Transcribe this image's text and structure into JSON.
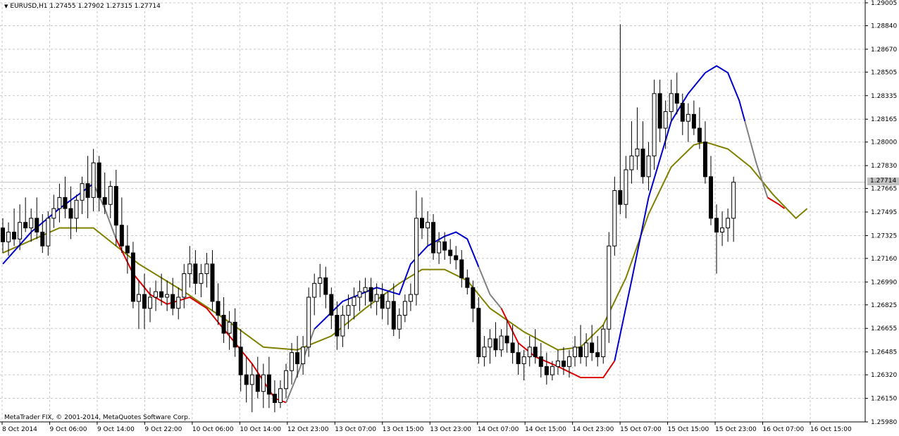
{
  "header": {
    "symbol_period": "EURUSD,H1",
    "open": "1.27455",
    "high": "1.27902",
    "low": "1.27315",
    "close": "1.27714"
  },
  "footer": {
    "copyright": "MetaTrader FIX, © 2001-2014, MetaQuotes Software Corp."
  },
  "current_price_label": "1.27714",
  "colors": {
    "background": "#ffffff",
    "grid": "#c8c8c8",
    "candle_bull_fill": "#ffffff",
    "candle_bear_fill": "#000000",
    "candle_outline": "#000000",
    "ma_slow": "#808000",
    "ma_fast_up": "#0000cc",
    "ma_fast_down": "#dd0000",
    "ma_fast_flat": "#808080",
    "bid_line": "#c0c0c0"
  },
  "chart_data": {
    "type": "candlestick",
    "symbol": "EURUSD",
    "timeframe": "H1",
    "grid": true,
    "ylim": [
      1.2598,
      1.29005
    ],
    "y_ticks": [
      "1.29005",
      "1.28840",
      "1.28670",
      "1.28505",
      "1.28335",
      "1.28165",
      "1.28000",
      "1.27830",
      "1.27665",
      "1.27495",
      "1.27325",
      "1.27160",
      "1.26990",
      "1.26825",
      "1.26655",
      "1.26485",
      "1.26320",
      "1.26150",
      "1.25980"
    ],
    "x_ticks": [
      "8 Oct 2014",
      "9 Oct 06:00",
      "9 Oct 14:00",
      "9 Oct 22:00",
      "10 Oct 06:00",
      "10 Oct 14:00",
      "12 Oct 23:00",
      "13 Oct 07:00",
      "13 Oct 15:00",
      "13 Oct 23:00",
      "14 Oct 07:00",
      "14 Oct 15:00",
      "14 Oct 23:00",
      "15 Oct 07:00",
      "15 Oct 15:00",
      "15 Oct 23:00",
      "16 Oct 07:00",
      "16 Oct 15:00"
    ],
    "candles": [
      [
        1.2738,
        1.2745,
        1.272,
        1.2728
      ],
      [
        1.2728,
        1.2742,
        1.2718,
        1.2735
      ],
      [
        1.2735,
        1.2752,
        1.2725,
        1.273
      ],
      [
        1.273,
        1.2755,
        1.2722,
        1.2742
      ],
      [
        1.2742,
        1.276,
        1.2735,
        1.2738
      ],
      [
        1.2738,
        1.2752,
        1.2728,
        1.2745
      ],
      [
        1.2745,
        1.276,
        1.273,
        1.2735
      ],
      [
        1.2735,
        1.2748,
        1.272,
        1.2725
      ],
      [
        1.2725,
        1.275,
        1.2718,
        1.2745
      ],
      [
        1.2745,
        1.2762,
        1.2738,
        1.2752
      ],
      [
        1.2752,
        1.277,
        1.2742,
        1.276
      ],
      [
        1.276,
        1.2775,
        1.2745,
        1.2752
      ],
      [
        1.2752,
        1.2768,
        1.273,
        1.2745
      ],
      [
        1.2745,
        1.2762,
        1.2735,
        1.2758
      ],
      [
        1.2758,
        1.2775,
        1.2748,
        1.277
      ],
      [
        1.277,
        1.279,
        1.2745,
        1.276
      ],
      [
        1.276,
        1.2795,
        1.275,
        1.2785
      ],
      [
        1.2785,
        1.279,
        1.275,
        1.276
      ],
      [
        1.276,
        1.2778,
        1.2748,
        1.2755
      ],
      [
        1.2755,
        1.2772,
        1.2745,
        1.2768
      ],
      [
        1.2768,
        1.278,
        1.2725,
        1.274
      ],
      [
        1.274,
        1.276,
        1.272,
        1.2725
      ],
      [
        1.2725,
        1.274,
        1.2705,
        1.272
      ],
      [
        1.272,
        1.2728,
        1.268,
        1.2685
      ],
      [
        1.2685,
        1.27,
        1.2665,
        1.269
      ],
      [
        1.269,
        1.2705,
        1.2665,
        1.268
      ],
      [
        1.268,
        1.2695,
        1.267,
        1.2688
      ],
      [
        1.2688,
        1.27,
        1.2678,
        1.2692
      ],
      [
        1.2692,
        1.2705,
        1.2682,
        1.2688
      ],
      [
        1.2688,
        1.27,
        1.2678,
        1.269
      ],
      [
        1.269,
        1.2702,
        1.2675,
        1.268
      ],
      [
        1.268,
        1.2695,
        1.2672,
        1.2688
      ],
      [
        1.2688,
        1.2712,
        1.268,
        1.2705
      ],
      [
        1.2705,
        1.2725,
        1.2695,
        1.2712
      ],
      [
        1.2712,
        1.2722,
        1.269,
        1.2698
      ],
      [
        1.2698,
        1.2712,
        1.2688,
        1.2705
      ],
      [
        1.2705,
        1.272,
        1.2695,
        1.2712
      ],
      [
        1.2712,
        1.2722,
        1.2678,
        1.2685
      ],
      [
        1.2685,
        1.2698,
        1.2668,
        1.2675
      ],
      [
        1.2675,
        1.2688,
        1.2655,
        1.2662
      ],
      [
        1.2662,
        1.2678,
        1.265,
        1.267
      ],
      [
        1.267,
        1.268,
        1.2645,
        1.2652
      ],
      [
        1.2652,
        1.2665,
        1.262,
        1.2632
      ],
      [
        1.2632,
        1.2645,
        1.2612,
        1.2625
      ],
      [
        1.2625,
        1.264,
        1.2605,
        1.2632
      ],
      [
        1.2632,
        1.2645,
        1.2615,
        1.262
      ],
      [
        1.262,
        1.264,
        1.2608,
        1.2632
      ],
      [
        1.2632,
        1.2645,
        1.2608,
        1.2618
      ],
      [
        1.2618,
        1.2628,
        1.2605,
        1.2612
      ],
      [
        1.2612,
        1.2628,
        1.2608,
        1.2622
      ],
      [
        1.2622,
        1.264,
        1.2615,
        1.2635
      ],
      [
        1.2635,
        1.2655,
        1.2625,
        1.2648
      ],
      [
        1.2648,
        1.266,
        1.263,
        1.264
      ],
      [
        1.264,
        1.266,
        1.2632,
        1.2652
      ],
      [
        1.2652,
        1.2695,
        1.2645,
        1.2688
      ],
      [
        1.2688,
        1.2705,
        1.2675,
        1.2698
      ],
      [
        1.2698,
        1.2712,
        1.2688,
        1.2702
      ],
      [
        1.2702,
        1.271,
        1.268,
        1.269
      ],
      [
        1.269,
        1.2695,
        1.2665,
        1.2675
      ],
      [
        1.2675,
        1.2685,
        1.265,
        1.266
      ],
      [
        1.266,
        1.2682,
        1.2652,
        1.2675
      ],
      [
        1.2675,
        1.269,
        1.2665,
        1.2682
      ],
      [
        1.2682,
        1.2695,
        1.2672,
        1.2688
      ],
      [
        1.2688,
        1.27,
        1.2678,
        1.2692
      ],
      [
        1.2692,
        1.2702,
        1.2682,
        1.2695
      ],
      [
        1.2695,
        1.2702,
        1.268,
        1.2685
      ],
      [
        1.2685,
        1.2698,
        1.2675,
        1.269
      ],
      [
        1.269,
        1.2698,
        1.2672,
        1.268
      ],
      [
        1.268,
        1.2692,
        1.2668,
        1.2685
      ],
      [
        1.2685,
        1.2698,
        1.266,
        1.2665
      ],
      [
        1.2665,
        1.268,
        1.2658,
        1.2675
      ],
      [
        1.2675,
        1.269,
        1.267,
        1.2685
      ],
      [
        1.2685,
        1.2698,
        1.2678,
        1.269
      ],
      [
        1.269,
        1.2765,
        1.2682,
        1.2745
      ],
      [
        1.2745,
        1.276,
        1.273,
        1.2738
      ],
      [
        1.2738,
        1.275,
        1.2725,
        1.2742
      ],
      [
        1.2742,
        1.2748,
        1.2715,
        1.272
      ],
      [
        1.272,
        1.2735,
        1.2712,
        1.2728
      ],
      [
        1.2728,
        1.2735,
        1.2715,
        1.2722
      ],
      [
        1.2722,
        1.273,
        1.2712,
        1.2718
      ],
      [
        1.2718,
        1.2725,
        1.2708,
        1.2715
      ],
      [
        1.2715,
        1.2722,
        1.2695,
        1.2702
      ],
      [
        1.2702,
        1.2708,
        1.269,
        1.2695
      ],
      [
        1.2695,
        1.27,
        1.267,
        1.268
      ],
      [
        1.268,
        1.2688,
        1.264,
        1.2645
      ],
      [
        1.2645,
        1.266,
        1.2638,
        1.2652
      ],
      [
        1.2652,
        1.2665,
        1.264,
        1.2658
      ],
      [
        1.2658,
        1.267,
        1.2645,
        1.265
      ],
      [
        1.265,
        1.2665,
        1.2645,
        1.266
      ],
      [
        1.266,
        1.2672,
        1.2648,
        1.2655
      ],
      [
        1.2655,
        1.2668,
        1.264,
        1.2648
      ],
      [
        1.2648,
        1.2655,
        1.2632,
        1.264
      ],
      [
        1.264,
        1.265,
        1.2628,
        1.2645
      ],
      [
        1.2645,
        1.266,
        1.2638,
        1.2652
      ],
      [
        1.2652,
        1.2665,
        1.264,
        1.2645
      ],
      [
        1.2645,
        1.2655,
        1.263,
        1.2638
      ],
      [
        1.2638,
        1.2648,
        1.2625,
        1.2632
      ],
      [
        1.2632,
        1.2642,
        1.2628,
        1.2638
      ],
      [
        1.2638,
        1.265,
        1.2632,
        1.2642
      ],
      [
        1.2642,
        1.2652,
        1.2632,
        1.2638
      ],
      [
        1.2638,
        1.265,
        1.263,
        1.2645
      ],
      [
        1.2645,
        1.266,
        1.2638,
        1.2652
      ],
      [
        1.2652,
        1.2668,
        1.264,
        1.2645
      ],
      [
        1.2645,
        1.2662,
        1.2638,
        1.2655
      ],
      [
        1.2655,
        1.2668,
        1.2642,
        1.2648
      ],
      [
        1.2648,
        1.266,
        1.2638,
        1.2645
      ],
      [
        1.2645,
        1.2668,
        1.264,
        1.2665
      ],
      [
        1.2665,
        1.2735,
        1.2655,
        1.2725
      ],
      [
        1.2725,
        1.2775,
        1.2718,
        1.2765
      ],
      [
        1.2765,
        1.2885,
        1.2748,
        1.2755
      ],
      [
        1.2755,
        1.279,
        1.2745,
        1.278
      ],
      [
        1.278,
        1.2815,
        1.277,
        1.279
      ],
      [
        1.279,
        1.2825,
        1.278,
        1.2795
      ],
      [
        1.2795,
        1.2815,
        1.277,
        1.2775
      ],
      [
        1.2775,
        1.28,
        1.2765,
        1.279
      ],
      [
        1.279,
        1.2845,
        1.278,
        1.2835
      ],
      [
        1.2835,
        1.2845,
        1.28,
        1.281
      ],
      [
        1.281,
        1.283,
        1.2795,
        1.2822
      ],
      [
        1.2822,
        1.2845,
        1.2815,
        1.2835
      ],
      [
        1.2835,
        1.285,
        1.282,
        1.2828
      ],
      [
        1.2828,
        1.2835,
        1.2805,
        1.2815
      ],
      [
        1.2815,
        1.2828,
        1.28,
        1.282
      ],
      [
        1.282,
        1.283,
        1.2805,
        1.281
      ],
      [
        1.281,
        1.2825,
        1.2795,
        1.28
      ],
      [
        1.28,
        1.2815,
        1.277,
        1.2775
      ],
      [
        1.2775,
        1.279,
        1.274,
        1.2745
      ],
      [
        1.2745,
        1.2755,
        1.2705,
        1.2735
      ],
      [
        1.2735,
        1.275,
        1.2725,
        1.2738
      ],
      [
        1.2738,
        1.2752,
        1.2728,
        1.2745
      ],
      [
        1.2745,
        1.2775,
        1.2728,
        1.2771
      ]
    ],
    "ma_slow": [
      [
        0,
        1.272
      ],
      [
        10,
        1.2738
      ],
      [
        16,
        1.2738
      ],
      [
        24,
        1.2712
      ],
      [
        32,
        1.2692
      ],
      [
        40,
        1.267
      ],
      [
        46,
        1.2652
      ],
      [
        52,
        1.265
      ],
      [
        58,
        1.266
      ],
      [
        64,
        1.268
      ],
      [
        70,
        1.2698
      ],
      [
        74,
        1.2708
      ],
      [
        78,
        1.2708
      ],
      [
        82,
        1.27
      ],
      [
        86,
        1.268
      ],
      [
        92,
        1.2663
      ],
      [
        98,
        1.265
      ],
      [
        102,
        1.2652
      ],
      [
        106,
        1.2668
      ],
      [
        110,
        1.2702
      ],
      [
        114,
        1.2748
      ],
      [
        118,
        1.2782
      ],
      [
        122,
        1.2798
      ],
      [
        124,
        1.28
      ],
      [
        128,
        1.2795
      ],
      [
        132,
        1.2782
      ],
      [
        136,
        1.2762
      ],
      [
        140,
        1.2745
      ],
      [
        142,
        1.2752
      ]
    ],
    "ma_fast": [
      {
        "color": "up",
        "points": [
          [
            0,
            1.2712
          ],
          [
            5,
            1.2735
          ],
          [
            10,
            1.2752
          ],
          [
            14,
            1.2764
          ],
          [
            16,
            1.277
          ]
        ]
      },
      {
        "color": "flat",
        "points": [
          [
            16,
            1.277
          ],
          [
            18,
            1.2752
          ],
          [
            20,
            1.273
          ]
        ]
      },
      {
        "color": "down",
        "points": [
          [
            20,
            1.273
          ],
          [
            23,
            1.2705
          ],
          [
            26,
            1.269
          ],
          [
            29,
            1.2683
          ],
          [
            33,
            1.2688
          ],
          [
            36,
            1.268
          ],
          [
            40,
            1.266
          ],
          [
            44,
            1.264
          ],
          [
            48,
            1.2615
          ],
          [
            50,
            1.2612
          ]
        ]
      },
      {
        "color": "flat",
        "points": [
          [
            50,
            1.2612
          ],
          [
            52,
            1.2632
          ],
          [
            55,
            1.2665
          ]
        ]
      },
      {
        "color": "up",
        "points": [
          [
            55,
            1.2665
          ],
          [
            60,
            1.2685
          ],
          [
            66,
            1.2695
          ],
          [
            70,
            1.269
          ],
          [
            72,
            1.2712
          ],
          [
            75,
            1.2725
          ],
          [
            78,
            1.2732
          ],
          [
            80,
            1.2735
          ],
          [
            82,
            1.273
          ],
          [
            84,
            1.271
          ]
        ]
      },
      {
        "color": "flat",
        "points": [
          [
            84,
            1.271
          ],
          [
            86,
            1.269
          ],
          [
            88,
            1.268
          ]
        ]
      },
      {
        "color": "down",
        "points": [
          [
            88,
            1.268
          ],
          [
            91,
            1.2655
          ],
          [
            94,
            1.2645
          ],
          [
            98,
            1.2638
          ],
          [
            102,
            1.263
          ],
          [
            106,
            1.263
          ],
          [
            108,
            1.2642
          ]
        ]
      },
      {
        "color": "up",
        "points": [
          [
            108,
            1.2642
          ],
          [
            111,
            1.27
          ],
          [
            114,
            1.276
          ],
          [
            118,
            1.2815
          ],
          [
            121,
            1.2835
          ],
          [
            124,
            1.285
          ],
          [
            126,
            1.2855
          ],
          [
            128,
            1.285
          ],
          [
            130,
            1.283
          ],
          [
            131,
            1.2815
          ]
        ]
      },
      {
        "color": "flat",
        "points": [
          [
            131,
            1.2815
          ],
          [
            133,
            1.2785
          ],
          [
            135,
            1.276
          ]
        ]
      },
      {
        "color": "down",
        "points": [
          [
            135,
            1.276
          ],
          [
            137,
            1.2755
          ],
          [
            138,
            1.2752
          ]
        ]
      }
    ]
  }
}
